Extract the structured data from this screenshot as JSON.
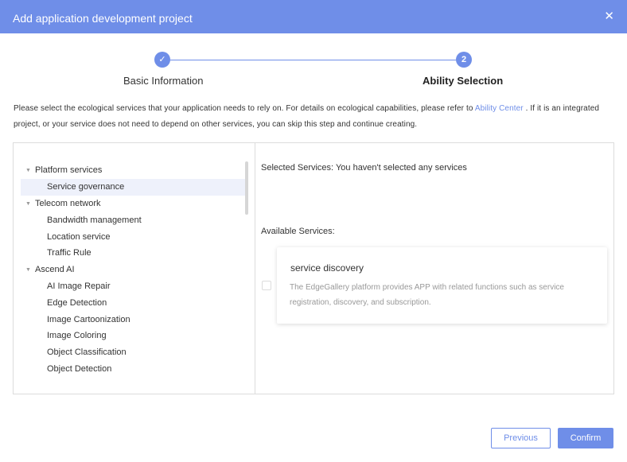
{
  "dialog": {
    "title": "Add application development project",
    "close_icon": "close-icon"
  },
  "steps": [
    {
      "label": "Basic Information",
      "indicator": "✓",
      "status": "done"
    },
    {
      "label": "Ability Selection",
      "indicator": "2",
      "status": "active"
    }
  ],
  "description": {
    "text_before": "Please select the ecological services that your application needs to rely on. For details on ecological capabilities, please refer to ",
    "link": "Ability Center",
    "text_after": " . If it is an integrated project, or your service does not need to depend on other services, you can skip this step and continue creating."
  },
  "tree": {
    "groups": [
      {
        "label": "Platform services",
        "children": [
          "Service governance"
        ]
      },
      {
        "label": "Telecom network",
        "children": [
          "Bandwidth management",
          "Location service",
          "Traffic Rule"
        ]
      },
      {
        "label": "Ascend AI",
        "children": [
          "AI Image Repair",
          "Edge Detection",
          "Image Cartoonization",
          "Image Coloring",
          "Object Classification",
          "Object Detection"
        ]
      }
    ],
    "selected": "Service governance"
  },
  "selected_services": {
    "text": "Selected Services: You haven't selected any services"
  },
  "available_services": {
    "label": "Available Services:",
    "items": [
      {
        "title": "service discovery",
        "description": "The EdgeGallery platform provides APP with related functions such as service registration, discovery, and subscription.",
        "checked": false
      }
    ]
  },
  "buttons": {
    "previous": "Previous",
    "confirm": "Confirm"
  },
  "colors": {
    "accent": "#6f8ee8",
    "header_bg": "#6f8ee8",
    "selected_bg": "#eef1fb"
  }
}
